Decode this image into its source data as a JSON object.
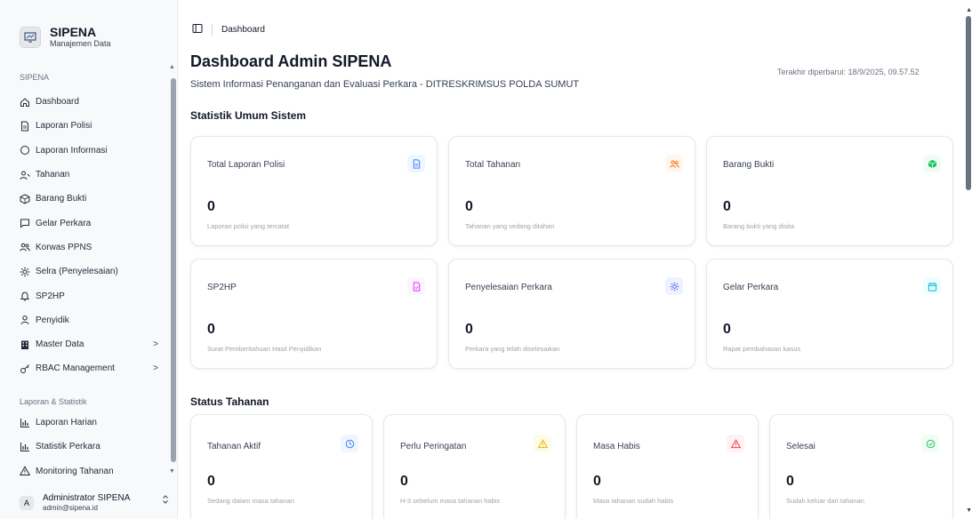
{
  "brand": {
    "title": "SIPENA",
    "subtitle": "Manajemen Data",
    "logo_text": "SIPENA"
  },
  "sidebar": {
    "group1_label": "SIPENA",
    "items": [
      {
        "label": "Dashboard",
        "icon": "home-icon"
      },
      {
        "label": "Laporan Polisi",
        "icon": "file-icon"
      },
      {
        "label": "Laporan Informasi",
        "icon": "circle-icon"
      },
      {
        "label": "Tahanan",
        "icon": "user-lock-icon"
      },
      {
        "label": "Barang Bukti",
        "icon": "box-icon"
      },
      {
        "label": "Gelar Perkara",
        "icon": "message-square-icon"
      },
      {
        "label": "Korwas PPNS",
        "icon": "users-icon"
      },
      {
        "label": "Selra (Penyelesaian)",
        "icon": "gear-icon"
      },
      {
        "label": "SP2HP",
        "icon": "bell-icon"
      },
      {
        "label": "Penyidik",
        "icon": "user-icon"
      },
      {
        "label": "Master Data",
        "icon": "building-icon",
        "chevron": ">"
      },
      {
        "label": "RBAC Management",
        "icon": "key-icon",
        "chevron": ">"
      }
    ],
    "group2_label": "Laporan & Statistik",
    "items2": [
      {
        "label": "Laporan Harian",
        "icon": "bar-chart-icon"
      },
      {
        "label": "Statistik Perkara",
        "icon": "bar-chart-icon"
      },
      {
        "label": "Monitoring Tahanan",
        "icon": "alert-triangle-icon"
      }
    ],
    "user": {
      "initial": "A",
      "name": "Administrator SIPENA",
      "email": "admin@sipena.id",
      "toggle": "⌃⌄"
    }
  },
  "header": {
    "breadcrumb": "Dashboard",
    "title": "Dashboard Admin SIPENA",
    "subtitle": "Sistem Informasi Penanganan dan Evaluasi Perkara - DITRESKRIMSUS POLDA SUMUT",
    "updated": "Terakhir diperbarui: 18/9/2025, 09.57.52"
  },
  "sections": {
    "general": "Statistik Umum Sistem",
    "detention": "Status Tahanan"
  },
  "stats": [
    {
      "title": "Total Laporan Polisi",
      "value": "0",
      "desc": "Laporan polisi yang tercatat",
      "icon": "file-text-icon",
      "color": "#3b82f6",
      "bg": "#eff6ff"
    },
    {
      "title": "Total Tahanan",
      "value": "0",
      "desc": "Tahanan yang sedang ditahan",
      "icon": "users-icon",
      "color": "#f97316",
      "bg": "#fff7ed"
    },
    {
      "title": "Barang Bukti",
      "value": "0",
      "desc": "Barang bukti yang disita",
      "icon": "box-icon",
      "color": "#22c55e",
      "bg": "#f0fdf4"
    },
    {
      "title": "SP2HP",
      "value": "0",
      "desc": "Surat Pemberitahuan Hasil Penyidikan",
      "icon": "file-icon",
      "color": "#d946ef",
      "bg": "#fdf4ff"
    },
    {
      "title": "Penyelesaian Perkara",
      "value": "0",
      "desc": "Perkara yang telah diselesaikan",
      "icon": "gear-icon",
      "color": "#6366f1",
      "bg": "#eef2ff"
    },
    {
      "title": "Gelar Perkara",
      "value": "0",
      "desc": "Rapat pembahasan kasus",
      "icon": "calendar-icon",
      "color": "#06b6d4",
      "bg": "#ecfeff"
    }
  ],
  "detention": [
    {
      "title": "Tahanan Aktif",
      "value": "0",
      "desc": "Sedang dalam masa tahanan",
      "icon": "clock-icon",
      "color": "#3b82f6",
      "bg": "#eff6ff"
    },
    {
      "title": "Perlu Peringatan",
      "value": "0",
      "desc": "H-3 sebelum masa tahanan habis",
      "icon": "alert-triangle-icon",
      "color": "#eab308",
      "bg": "#fefce8"
    },
    {
      "title": "Masa Habis",
      "value": "0",
      "desc": "Masa tahanan sudah habis",
      "icon": "alert-triangle-icon",
      "color": "#ef4444",
      "bg": "#fef2f2"
    },
    {
      "title": "Selesai",
      "value": "0",
      "desc": "Sudah keluar dari tahanan",
      "icon": "check-circle-icon",
      "color": "#22c55e",
      "bg": "#f0fdf4"
    }
  ]
}
